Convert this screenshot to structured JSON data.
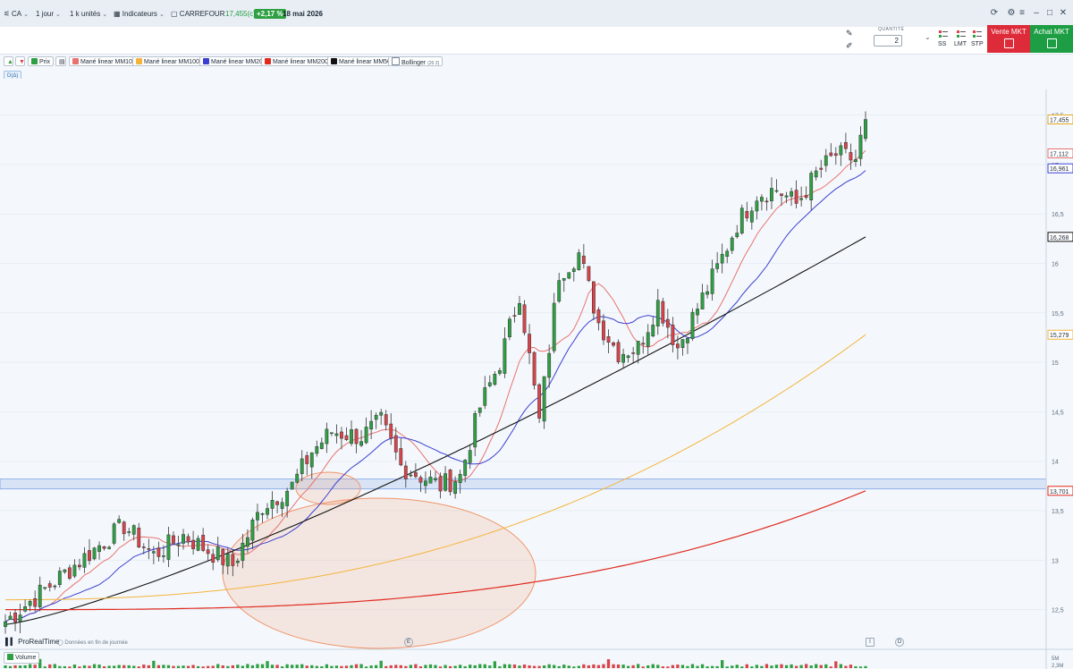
{
  "toolbar": {
    "ticker": "CA",
    "timeframe": "1 jour",
    "units": "1 k unités",
    "indicators": "Indicateurs",
    "instrument": "CARREFOUR",
    "price": "17,455(c)",
    "change": "+2,17 %",
    "date": "18 mai 2026"
  },
  "order": {
    "qty_label": "QUANTITÉ",
    "qty_value": "2",
    "types": [
      "SS",
      "LMT",
      "STP"
    ],
    "sell_label": "Vente MKT",
    "buy_label": "Achat MKT"
  },
  "legend": {
    "price": "Prix",
    "indicators": [
      {
        "label": "Mané linear MM10",
        "color": "#e8726f"
      },
      {
        "label": "Mané linear MM100",
        "color": "#f4b43a"
      },
      {
        "label": "Mané linear MM20",
        "color": "#3b3fd1"
      },
      {
        "label": "Mané linear MM200",
        "color": "#e02a1e"
      },
      {
        "label": "Mané linear MM50",
        "color": "#111111"
      }
    ],
    "bollinger": "Bollinger",
    "bollinger_params": "(20 2)",
    "period": "D(Δ)"
  },
  "footer": {
    "brand": "ProRealTime",
    "note": "Données en fin de journée",
    "volume_label": "Volume",
    "volume_ticks": [
      "5M",
      "2,3M"
    ]
  },
  "colors": {
    "up": "#2ea043",
    "down": "#d9434b",
    "mm10": "#e8726f",
    "mm20": "#3b3fd1",
    "mm50": "#111111",
    "mm100": "#f4b43a",
    "mm200": "#e02a1e",
    "zone": "#3b6fd8",
    "ellipse": "#f0956a"
  },
  "chart_data": {
    "type": "candlestick",
    "yaxis_ticks": [
      17.5,
      17,
      16.5,
      16,
      15.5,
      15,
      14.5,
      14,
      13.5,
      13,
      12.5
    ],
    "ylim": [
      12.37,
      17.65
    ],
    "price_tags": [
      {
        "value": 17.455,
        "label": "17,455",
        "color": "#e3a51a"
      },
      {
        "value": 17.112,
        "label": "17,112",
        "color": "#e8726f"
      },
      {
        "value": 16.961,
        "label": "16,961",
        "color": "#3b3fd1"
      },
      {
        "value": 16.268,
        "label": "16,268",
        "color": "#111111"
      },
      {
        "value": 15.279,
        "label": "15,279",
        "color": "#f4b43a"
      },
      {
        "value": 13.701,
        "label": "13,701",
        "color": "#e02a1e"
      }
    ],
    "zone": {
      "low": 13.72,
      "high": 13.82
    },
    "anchors": [
      [
        0,
        12.38
      ],
      [
        14,
        12.95
      ],
      [
        24,
        13.35
      ],
      [
        30,
        13.05
      ],
      [
        36,
        13.25
      ],
      [
        46,
        12.95
      ],
      [
        52,
        13.55
      ],
      [
        58,
        13.75
      ],
      [
        62,
        14.1
      ],
      [
        66,
        14.3
      ],
      [
        72,
        14.25
      ],
      [
        76,
        14.4
      ],
      [
        80,
        13.95
      ],
      [
        88,
        13.75
      ],
      [
        92,
        13.85
      ],
      [
        96,
        14.55
      ],
      [
        100,
        15.0
      ],
      [
        104,
        15.7
      ],
      [
        108,
        14.4
      ],
      [
        112,
        15.9
      ],
      [
        116,
        16.1
      ],
      [
        120,
        15.4
      ],
      [
        124,
        15.1
      ],
      [
        128,
        15.15
      ],
      [
        132,
        15.6
      ],
      [
        136,
        15.15
      ],
      [
        140,
        15.55
      ],
      [
        144,
        15.95
      ],
      [
        148,
        16.4
      ],
      [
        152,
        16.7
      ],
      [
        156,
        16.75
      ],
      [
        160,
        16.6
      ],
      [
        164,
        16.9
      ],
      [
        168,
        17.1
      ],
      [
        172,
        17.05
      ],
      [
        174,
        17.455
      ]
    ],
    "candle_count": 175,
    "volume_max": 5
  }
}
